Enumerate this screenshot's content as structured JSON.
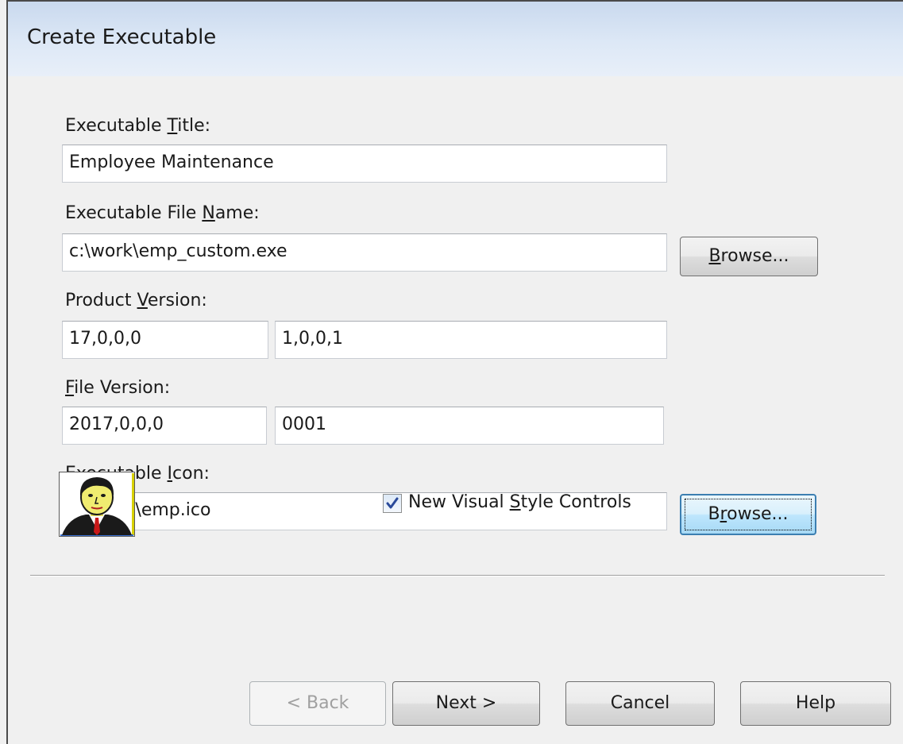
{
  "window": {
    "title": "Create Executable"
  },
  "form": {
    "title_label_pre": "Executable ",
    "title_label_ul": "T",
    "title_label_post": "itle:",
    "title_value": "Employee Maintenance",
    "filename_label_pre": "Executable File ",
    "filename_label_ul": "N",
    "filename_label_post": "ame:",
    "filename_value": "c:\\work\\emp_custom.exe",
    "product_version_label_pre": "Product ",
    "product_version_label_ul": "V",
    "product_version_label_post": "ersion:",
    "product_version_value_1": "17,0,0,0",
    "product_version_value_2": "1,0,0,1",
    "file_version_label_ul": "F",
    "file_version_label_post": "ile Version:",
    "file_version_value_1": "2017,0,0,0",
    "file_version_value_2": "0001",
    "icon_label_pre": "Executable ",
    "icon_label_ul": "I",
    "icon_label_post": "con:",
    "icon_value": "C:\\work\\emp.ico",
    "browse_1_ul": "B",
    "browse_1_post": "rowse...",
    "browse_2_pre": "B",
    "browse_2_ul": "r",
    "browse_2_post": "owse...",
    "checkbox_checked": true,
    "checkbox_label_pre": "New Visual ",
    "checkbox_label_ul": "S",
    "checkbox_label_post": "tyle Controls",
    "icon_preview": "person-icon"
  },
  "buttons": {
    "back": "< Back",
    "next": "Next >",
    "cancel": "Cancel",
    "help": "Help"
  },
  "colors": {
    "titlebar_top": "#c9d9ee",
    "dialog_bg": "#f0f0f0",
    "focus_border": "#3c7fb1"
  }
}
